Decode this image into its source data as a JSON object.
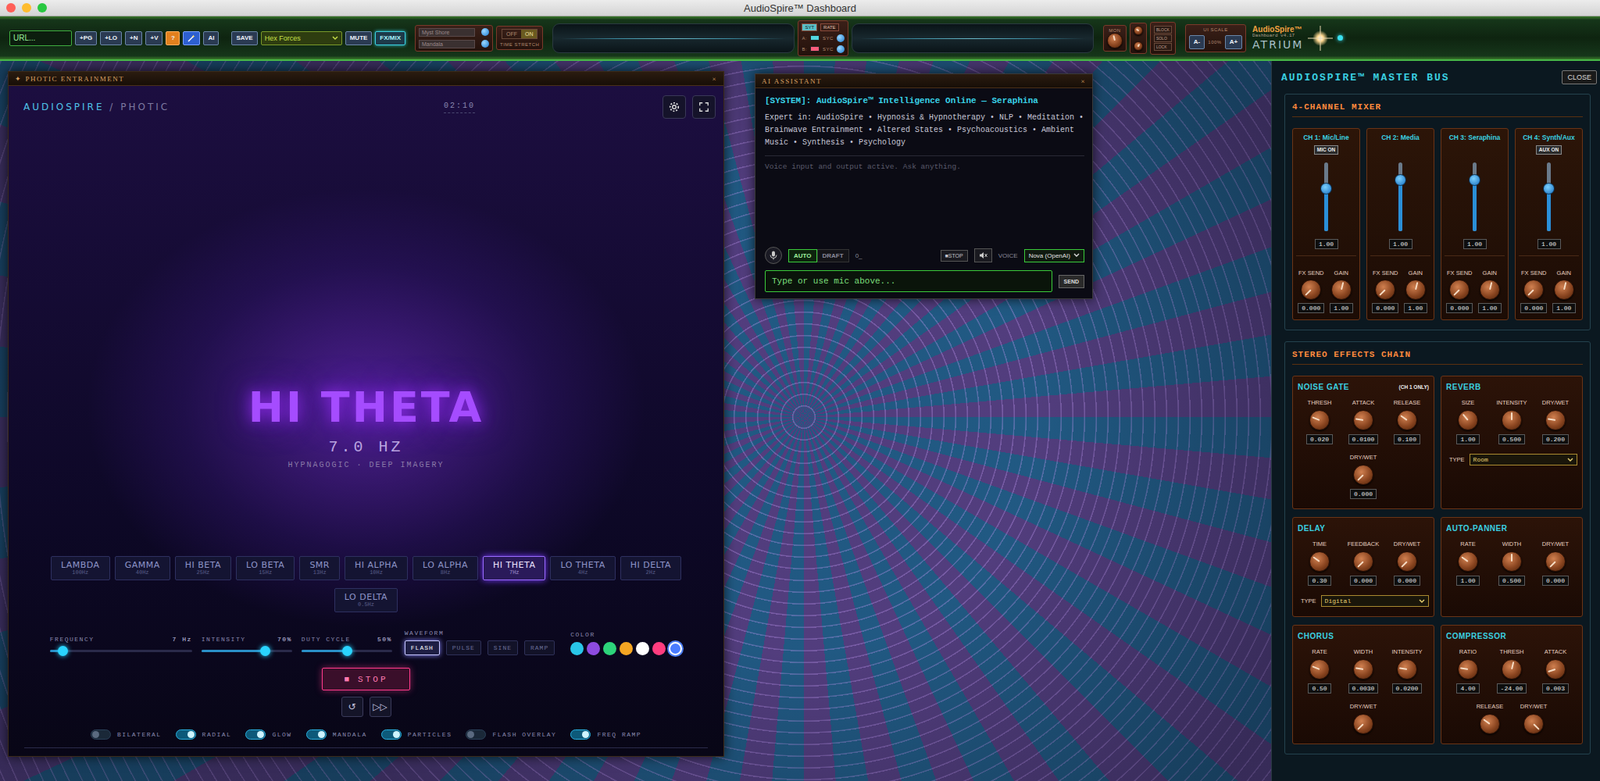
{
  "window": {
    "title": "AudioSpire™ Dashboard"
  },
  "toolbar": {
    "url": {
      "placeholder": "URL..."
    },
    "buttons": [
      "+PG",
      "+LO",
      "+N",
      "+V"
    ],
    "help": "?",
    "ai": "AI",
    "save": "SAVE",
    "preset": "Hex Forces",
    "mute": "MUTE",
    "fxmix": {
      "label": "FX/MIX",
      "selected": true
    },
    "slots": [
      "Myst Shore",
      "Mandala"
    ],
    "stretch": {
      "off": "OFF",
      "on": "ON",
      "on_state": true,
      "label": "TIME STRETCH"
    },
    "mini_mixer": {
      "tabs": [
        {
          "label": "SYT",
          "selected": true
        },
        {
          "label": "RATE",
          "selected": false
        }
      ],
      "rows": [
        {
          "label": "A:",
          "value": "SYC",
          "color": "#52d6e0"
        },
        {
          "label": "B:",
          "value": "SYC",
          "color": "#ff5c7c"
        }
      ]
    },
    "monitor": {
      "label": "MON",
      "level": 0.45
    },
    "knobs": [
      {
        "level": 0.3
      },
      {
        "level": 0.6
      }
    ],
    "side_buttons": [
      "BLOCK",
      "SOLO",
      "LOCK"
    ],
    "ui_scale": {
      "label": "UI SCALE",
      "minus": "A-",
      "value": "100%",
      "plus": "A+"
    },
    "logo": {
      "name": "AudioSpire™",
      "version": "Dashboard v4.17",
      "brand": "ATRIUM"
    }
  },
  "photic": {
    "icon": "✦",
    "title": "PHOTIC ENTRAINMENT",
    "close": "×",
    "brand": "AUDIOSPIRE",
    "brand_sub": "/ PHOTIC",
    "timer": "02:10",
    "current": {
      "name": "HI THETA",
      "freq": "7.0 HZ",
      "desc": "HYPNAGOGIC · DEEP IMAGERY"
    },
    "bands": [
      {
        "name": "LAMBDA",
        "hz": "100Hz",
        "selected": false
      },
      {
        "name": "GAMMA",
        "hz": "40Hz",
        "selected": false
      },
      {
        "name": "HI BETA",
        "hz": "25Hz",
        "selected": false
      },
      {
        "name": "LO BETA",
        "hz": "15Hz",
        "selected": false
      },
      {
        "name": "SMR",
        "hz": "13Hz",
        "selected": false
      },
      {
        "name": "HI ALPHA",
        "hz": "10Hz",
        "selected": false
      },
      {
        "name": "LO ALPHA",
        "hz": "8Hz",
        "selected": false
      },
      {
        "name": "HI THETA",
        "hz": "7Hz",
        "selected": true
      },
      {
        "name": "LO THETA",
        "hz": "4Hz",
        "selected": false
      },
      {
        "name": "HI DELTA",
        "hz": "2Hz",
        "selected": false
      },
      {
        "name": "LO DELTA",
        "hz": "0.5Hz",
        "selected": false
      }
    ],
    "sliders": [
      {
        "label": "FREQUENCY",
        "value": "7 Hz",
        "level": 0.09
      },
      {
        "label": "INTENSITY",
        "value": "70%",
        "level": 0.7
      },
      {
        "label": "DUTY CYCLE",
        "value": "50%",
        "level": 0.5
      }
    ],
    "waveform": {
      "label": "WAVEFORM",
      "options": [
        {
          "label": "FLASH",
          "selected": true
        },
        {
          "label": "PULSE",
          "selected": false
        },
        {
          "label": "SINE",
          "selected": false
        },
        {
          "label": "RAMP",
          "selected": false
        }
      ]
    },
    "color": {
      "label": "COLOR",
      "options": [
        {
          "color": "#29c6e8",
          "selected": false
        },
        {
          "color": "#8d4be0",
          "selected": false
        },
        {
          "color": "#2dd47a",
          "selected": false
        },
        {
          "color": "#f5a623",
          "selected": false
        },
        {
          "color": "#ffffff",
          "selected": false
        },
        {
          "color": "#ff3d7f",
          "selected": false
        },
        {
          "color": "#4a7cff",
          "selected": true
        }
      ]
    },
    "stop": {
      "icon": "■",
      "label": "STOP"
    },
    "transport": [
      "↺",
      "▷▷"
    ],
    "toggles": [
      {
        "label": "BILATERAL",
        "on": false
      },
      {
        "label": "RADIAL",
        "on": true
      },
      {
        "label": "GLOW",
        "on": true
      },
      {
        "label": "MANDALA",
        "on": true
      },
      {
        "label": "PARTICLES",
        "on": true
      },
      {
        "label": "FLASH OVERLAY",
        "on": false
      },
      {
        "label": "FREQ RAMP",
        "on": true
      }
    ]
  },
  "assistant": {
    "title": "AI ASSISTANT",
    "close": "×",
    "system": "[SYSTEM]: AudioSpire™ Intelligence Online — Seraphina",
    "expert": "Expert in: AudioSpire • Hypnosis & Hypnotherapy • NLP • Meditation • Brainwave Entrainment • Altered States • Psychoacoustics • Ambient Music • Synthesis • Psychology",
    "hint": "Voice input and output active. Ask anything.",
    "modes": [
      {
        "label": "AUTO",
        "selected": true
      },
      {
        "label": "DRAFT",
        "selected": false
      }
    ],
    "counter": "0_",
    "stop": "■STOP",
    "voice_label": "VOICE",
    "voice": "Nova (OpenAI)",
    "placeholder": "Type or use mic above...",
    "send": "SEND"
  },
  "master": {
    "title": "AUDIOSPIRE™ MASTER BUS",
    "close": "CLOSE",
    "mixer_title": "4-CHANNEL MIXER",
    "channels": [
      {
        "name": "CH 1: Mic/Line",
        "button": "MIC ON",
        "level": 0.62,
        "value": "1.00",
        "fx_label": "FX SEND",
        "fx": "0.000",
        "fx_level": 0.0,
        "gain_label": "GAIN",
        "gain": "1.00",
        "gain_level": 0.55
      },
      {
        "name": "CH 2: Media",
        "level": 0.75,
        "value": "1.00",
        "fx_label": "FX SEND",
        "fx": "0.000",
        "fx_level": 0.0,
        "gain_label": "GAIN",
        "gain": "1.00",
        "gain_level": 0.55
      },
      {
        "name": "CH 3: Seraphina",
        "level": 0.75,
        "value": "1.00",
        "fx_label": "FX SEND",
        "fx": "0.000",
        "fx_level": 0.0,
        "gain_label": "GAIN",
        "gain": "1.00",
        "gain_level": 0.55
      },
      {
        "name": "CH 4: Synth/Aux",
        "button": "AUX ON",
        "level": 0.62,
        "value": "1.00",
        "fx_label": "FX SEND",
        "fx": "0.000",
        "fx_level": 0.0,
        "gain_label": "GAIN",
        "gain": "1.00",
        "gain_level": 0.55
      }
    ],
    "effects_title": "STEREO EFFECTS CHAIN",
    "effects": [
      {
        "name": "NOISE GATE",
        "note": "(CH 1 ONLY)",
        "params": [
          {
            "label": "THRESH",
            "value": "0.020",
            "level": 0.25
          },
          {
            "label": "ATTACK",
            "value": "0.0100",
            "level": 0.2
          },
          {
            "label": "RELEASE",
            "value": "0.100",
            "level": 0.3
          },
          {
            "label": "DRY/WET",
            "value": "0.000",
            "level": 0.0
          }
        ]
      },
      {
        "name": "REVERB",
        "params": [
          {
            "label": "SIZE",
            "value": "1.00",
            "level": 0.35
          },
          {
            "label": "INTENSITY",
            "value": "0.500",
            "level": 0.5
          },
          {
            "label": "DRY/WET",
            "value": "0.200",
            "level": 0.2
          }
        ],
        "type": {
          "label": "TYPE",
          "value": "Room"
        }
      },
      {
        "name": "DELAY",
        "params": [
          {
            "label": "TIME",
            "value": "0.30",
            "level": 0.3
          },
          {
            "label": "FEEDBACK",
            "value": "0.000",
            "level": 0.0
          },
          {
            "label": "DRY/WET",
            "value": "0.000",
            "level": 0.0
          }
        ],
        "type": {
          "label": "TYPE",
          "value": "Digital"
        }
      },
      {
        "name": "AUTO-PANNER",
        "params": [
          {
            "label": "RATE",
            "value": "1.00",
            "level": 0.3
          },
          {
            "label": "WIDTH",
            "value": "0.500",
            "level": 0.5
          },
          {
            "label": "DRY/WET",
            "value": "0.000",
            "level": 0.0
          }
        ]
      },
      {
        "name": "CHORUS",
        "params": [
          {
            "label": "RATE",
            "value": "0.50",
            "level": 0.25
          },
          {
            "label": "WIDTH",
            "value": "0.0030",
            "level": 0.2
          },
          {
            "label": "INTENSITY",
            "value": "0.0200",
            "level": 0.2
          },
          {
            "label": "DRY/WET",
            "level": 0.0
          }
        ]
      },
      {
        "name": "COMPRESSOR",
        "params": [
          {
            "label": "RATIO",
            "value": "4.00",
            "level": 0.2
          },
          {
            "label": "THRESH",
            "value": "-24.00",
            "level": 0.55
          },
          {
            "label": "ATTACK",
            "value": "0.003",
            "level": 0.1
          },
          {
            "label": "RELEASE",
            "level": 0.3
          },
          {
            "label": "DRY/WET",
            "level": 1.0
          }
        ]
      }
    ]
  }
}
